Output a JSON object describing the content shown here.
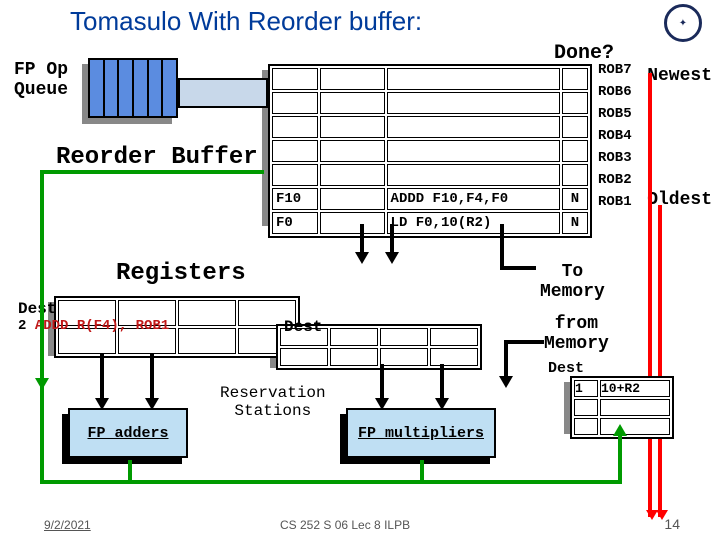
{
  "title": "Tomasulo With Reorder buffer:",
  "fp_op_queue_label": "FP Op\nQueue",
  "done_label": "Done?",
  "rob_title": "Reorder Buffer",
  "rob_rows": [
    {
      "dest": "",
      "src": "",
      "instr": "",
      "done": ""
    },
    {
      "dest": "",
      "src": "",
      "instr": "",
      "done": ""
    },
    {
      "dest": "",
      "src": "",
      "instr": "",
      "done": ""
    },
    {
      "dest": "",
      "src": "",
      "instr": "",
      "done": ""
    },
    {
      "dest": "",
      "src": "",
      "instr": "",
      "done": ""
    },
    {
      "dest": "F10",
      "src": "",
      "instr": "ADDD F10,F4,F0",
      "done": "N"
    },
    {
      "dest": "F0",
      "src": "",
      "instr": "LD F0,10(R2)",
      "done": "N"
    }
  ],
  "rob_labels": [
    "ROB7",
    "ROB6",
    "ROB5",
    "ROB4",
    "ROB3",
    "ROB2",
    "ROB1"
  ],
  "newest": "Newest",
  "oldest": "Oldest",
  "registers_title": "Registers",
  "dest_label": "Dest",
  "rs_adder_entry": {
    "tag": "2",
    "op": "ADDD",
    "src1": "R(F4)",
    "src2": ", ROB1"
  },
  "to_memory": "To\nMemory",
  "from_memory": "from\nMemory",
  "mem_queue": {
    "tag": "1",
    "addr": "10+R2"
  },
  "fp_adders": "FP adders",
  "fp_multipliers": "FP multipliers",
  "rs_label": "Reservation\nStations",
  "footer_date": "9/2/2021",
  "footer_center": "CS 252 S 06 Lec 8 ILPB",
  "footer_page": "14"
}
